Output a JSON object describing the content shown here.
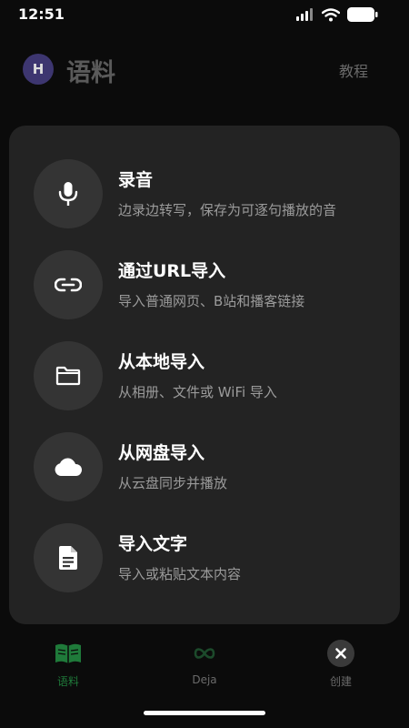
{
  "status_bar": {
    "time": "12:51"
  },
  "header": {
    "avatar_letter": "H",
    "title": "语料",
    "tutorial": "教程"
  },
  "create_menu": {
    "items": [
      {
        "icon": "microphone-icon",
        "title": "录音",
        "description": "边录边转写，保存为可逐句播放的音"
      },
      {
        "icon": "link-icon",
        "title": "通过URL导入",
        "description": "导入普通网页、B站和播客链接"
      },
      {
        "icon": "folder-icon",
        "title": "从本地导入",
        "description": "从相册、文件或 WiFi 导入"
      },
      {
        "icon": "cloud-icon",
        "title": "从网盘导入",
        "description": "从云盘同步并播放"
      },
      {
        "icon": "document-icon",
        "title": "导入文字",
        "description": "导入或粘贴文本内容"
      }
    ]
  },
  "tab_bar": {
    "tabs": [
      {
        "label": "语料",
        "icon": "book-icon",
        "active": true
      },
      {
        "label": "Deja",
        "icon": "infinity-icon",
        "active": false
      },
      {
        "label": "创建",
        "icon": "close-icon",
        "active": false
      }
    ]
  },
  "colors": {
    "accent_green": "#1f7a3a",
    "sheet_bg": "#232323",
    "icon_circle": "#343434"
  }
}
